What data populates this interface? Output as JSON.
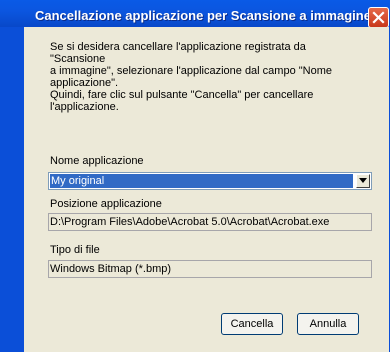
{
  "dialog": {
    "title": "Cancellazione applicazione per Scansione a immagine",
    "instructions": "Se si desidera cancellare l'applicazione registrata da \"Scansione\na immagine\", selezionare l'applicazione dal campo \"Nome\napplicazione\".\nQuindi, fare clic sul pulsante \"Cancella\" per cancellare\nl'applicazione.",
    "app_name_label": "Nome applicazione",
    "app_name_value": "My original",
    "app_path_label": "Posizione applicazione",
    "app_path_value": "D:\\Program Files\\Adobe\\Acrobat 5.0\\Acrobat\\Acrobat.exe",
    "file_type_label": "Tipo di file",
    "file_type_value": "Windows Bitmap (*.bmp)",
    "delete_label": "Cancella",
    "cancel_label": "Annulla"
  },
  "icons": {
    "close": "close-icon",
    "dropdown": "chevron-down-icon"
  },
  "colors": {
    "titlebar": "#0b56e0",
    "client": "#ece9d8",
    "selection": "#316ac5",
    "close_button": "#d4491f"
  }
}
